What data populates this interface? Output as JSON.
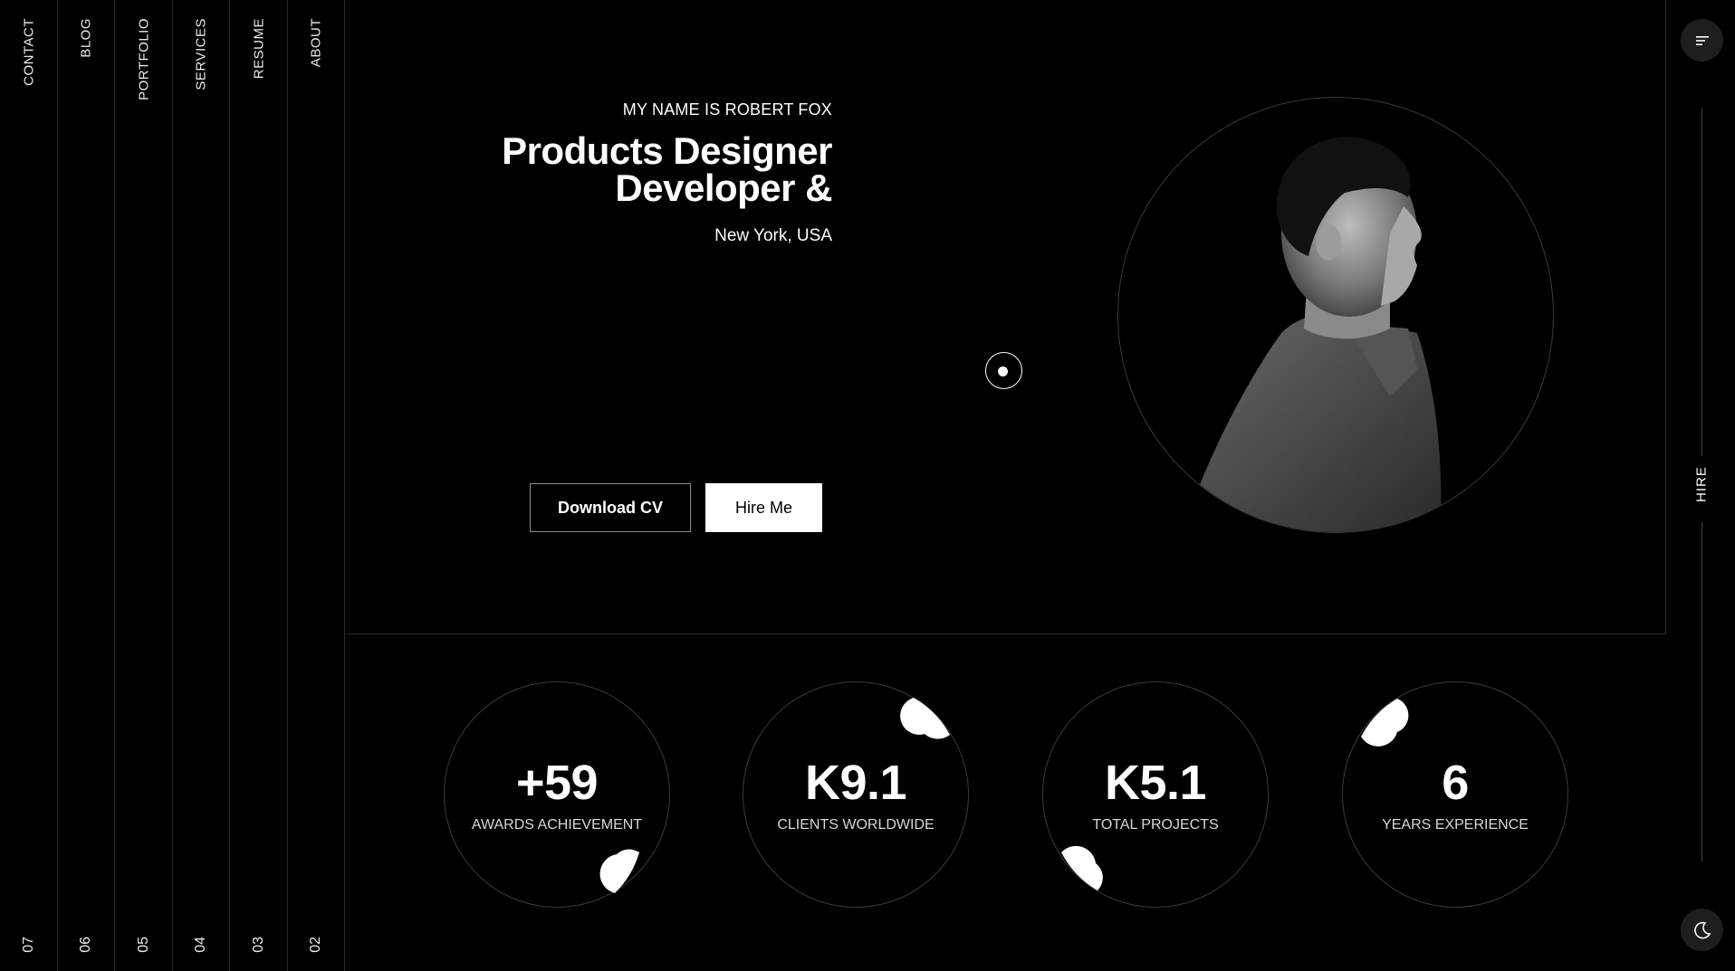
{
  "nav": {
    "items": [
      {
        "label": "CONTACT",
        "num": "07"
      },
      {
        "label": "BLOG",
        "num": "06"
      },
      {
        "label": "PORTFOLIO",
        "num": "05"
      },
      {
        "label": "SERVICES",
        "num": "04"
      },
      {
        "label": "RESUME",
        "num": "03"
      },
      {
        "label": "ABOUT",
        "num": "02"
      }
    ]
  },
  "hero": {
    "intro": "MY NAME IS ROBERT FOX",
    "title_line1": "Products Designer",
    "title_line2": "Developer &",
    "location": "New York, USA",
    "download_label": "Download CV",
    "hire_label": "Hire Me"
  },
  "right_rail": {
    "menu_icon": "menu-icon",
    "hire_text": "HIRE",
    "theme_icon": "moon-icon"
  },
  "stats": [
    {
      "value": "+59",
      "label": "AWARDS ACHIEVEMENT"
    },
    {
      "value": "K9.1",
      "label": "CLIENTS WORLDWIDE"
    },
    {
      "value": "K5.1",
      "label": "TOTAL PROJECTS"
    },
    {
      "value": "6",
      "label": "YEARS EXPERIENCE"
    }
  ],
  "colors": {
    "background": "#000000",
    "text": "#ffffff",
    "divider": "#2a2a2a",
    "button_bg": "#ffffff"
  }
}
